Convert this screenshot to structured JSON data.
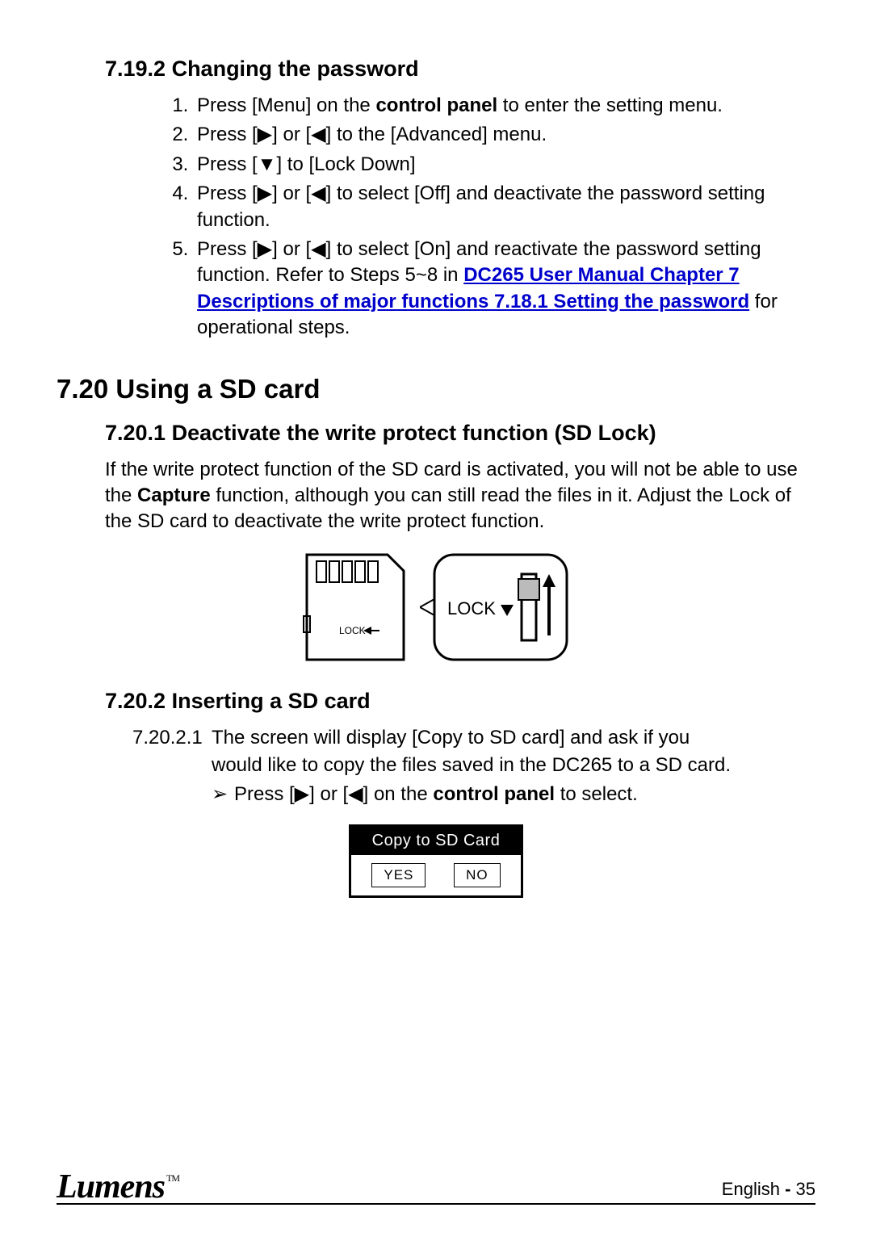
{
  "section_7_19_2": {
    "title": "7.19.2  Changing the password",
    "steps": [
      {
        "pre": "Press [Menu] on the ",
        "bold": "control panel",
        "post": " to enter the setting menu."
      },
      {
        "full": "Press [▶] or [◀] to the [Advanced] menu."
      },
      {
        "full": "Press [▼] to [Lock Down]"
      },
      {
        "full": "Press [▶] or [◀] to select [Off] and deactivate the password setting function."
      },
      {
        "pre": "Press [▶] or [◀] to select [On] and reactivate the password setting function. Refer to Steps 5~8 in ",
        "link": "DC265 User Manual Chapter 7 Descriptions of major functions 7.18.1 Setting the password",
        "post": " for operational steps."
      }
    ]
  },
  "section_7_20": {
    "title": "7.20  Using a SD card"
  },
  "section_7_20_1": {
    "title": "7.20.1  Deactivate the write protect function (SD Lock)",
    "para_pre": "If the write protect function of the SD card is activated, you will not be able to use the ",
    "para_bold": "Capture",
    "para_post": " function, although you can still read the files in it. Adjust the Lock of the SD card to deactivate the write protect function.",
    "diagram_labels": {
      "small": "LOCK",
      "big": "LOCK"
    }
  },
  "section_7_20_2": {
    "title": "7.20.2  Inserting a SD card",
    "item_num": "7.20.2.1",
    "item_line1": "The screen will display [Copy to SD card] and ask if you",
    "item_line2": "would like to copy the files saved in the DC265 to a SD card.",
    "bullet_pre": "Press [▶] or [◀] on the ",
    "bullet_bold": "control panel",
    "bullet_post": " to select."
  },
  "dialog": {
    "title": "Copy to SD Card",
    "yes": "YES",
    "no": "NO"
  },
  "footer": {
    "brand": "Lumens",
    "tm": "TM",
    "lang": "English",
    "sep": " - ",
    "page": "35"
  }
}
